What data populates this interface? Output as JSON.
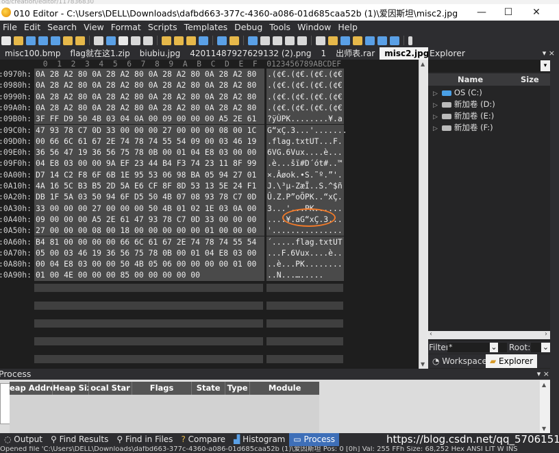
{
  "top_strip": "og/creation/editor/117836830",
  "window": {
    "title": "010 Editor - C:\\Users\\DELL\\Downloads\\dafbd663-377c-4360-a086-01d685caa52b (1)\\爱因斯坦\\misc2.jpg",
    "minimize": "—",
    "maximize": "☐",
    "close": "✕"
  },
  "menu": [
    "File",
    "Edit",
    "Search",
    "View",
    "Format",
    "Scripts",
    "Templates",
    "Debug",
    "Tools",
    "Window",
    "Help"
  ],
  "tabs": [
    "misc100.bmp",
    "flag就在这1.zip",
    "biubiu.jpg",
    "42011487927629132 (2).png",
    "1",
    "出师表.rar",
    "misc2.jpg"
  ],
  "tab_close": "×",
  "tab_arrows": "‹ › ▿",
  "explorer": {
    "title": "Explorer",
    "title_controls": "▾ ×",
    "dropdown_arrow": "▾",
    "col_name": "Name",
    "col_size": "Size",
    "items": [
      "OS (C:)",
      "新加卷 (D:)",
      "新加卷 (E:)",
      "新加卷 (F:)"
    ],
    "filter_label": "Filter:",
    "filter_value": "*",
    "root_label": "Root:",
    "tab_workspace": "Workspace",
    "tab_explorer": "Explorer"
  },
  "hex": {
    "header": " 0  1  2  3  4  5  6  7  8  9  A  B  C  D  E  F  0123456789ABCDEF",
    "rows": [
      {
        "addr": ":0970h:",
        "hex": "0A 28 A2 80 0A 28 A2 80 0A 28 A2 80 0A 28 A2 80",
        "ascii": ".(¢€.(¢€.(¢€.(¢€"
      },
      {
        "addr": ":0980h:",
        "hex": "0A 28 A2 80 0A 28 A2 80 0A 28 A2 80 0A 28 A2 80",
        "ascii": ".(¢€.(¢€.(¢€.(¢€"
      },
      {
        "addr": ":0990h:",
        "hex": "0A 28 A2 80 0A 28 A2 80 0A 28 A2 80 0A 28 A2 80",
        "ascii": ".(¢€.(¢€.(¢€.(¢€"
      },
      {
        "addr": ":09A0h:",
        "hex": "0A 28 A2 80 0A 28 A2 80 0A 28 A2 80 0A 28 A2 80",
        "ascii": ".(¢€.(¢€.(¢€.(¢€"
      },
      {
        "addr": ":09B0h:",
        "hex": "3F FF D9 50 4B 03 04 0A 00 09 00 00 00 A5 2E 61",
        "ascii": "?ÿÙPK........¥.a"
      },
      {
        "addr": ":09C0h:",
        "hex": "47 93 78 C7 0D 33 00 00 00 27 00 00 00 08 00 1C",
        "ascii": "G“xÇ.3...'......."
      },
      {
        "addr": ":09D0h:",
        "hex": "00 66 6C 61 67 2E 74 78 74 55 54 09 00 03 46 19",
        "ascii": ".flag.txtUT...F."
      },
      {
        "addr": ":09E0h:",
        "hex": "36 56 47 19 36 56 75 78 0B 00 01 04 E8 03 00 00",
        "ascii": "6VG.6Vux....è..."
      },
      {
        "addr": ":09F0h:",
        "hex": "04 E8 03 00 00 9A EF 23 44 B4 F3 74 23 11 8F 99",
        "ascii": ".è...šï#D´ót#..™"
      },
      {
        "addr": ":0A00h:",
        "hex": "D7 14 C2 F8 6F 6B 1E 95 53 06 98 BA 05 94 27 01",
        "ascii": "×.Âøok.•S.˜º.”'."
      },
      {
        "addr": ":0A10h:",
        "hex": "4A 16 5C B3 B5 2D 5A E6 CF 8F 8D 53 13 5E 24 F1",
        "ascii": "J.\\³µ-ZæÏ..S.^$ñ"
      },
      {
        "addr": ":0A20h:",
        "hex": "DB 1F 5A 03 50 94 6F D5 50 4B 07 08 93 78 C7 0D",
        "ascii": "Û.Z.P”oÕPK..“xÇ."
      },
      {
        "addr": ":0A30h:",
        "hex": "33 00 00 00 27 00 00 00 50 4B 01 02 1E 03 0A 00",
        "ascii": "3...'...PK......"
      },
      {
        "addr": ":0A40h:",
        "hex": "09 00 00 00 A5 2E 61 47 93 78 C7 0D 33 00 00 00",
        "ascii": "....¥.aG“xÇ.3..."
      },
      {
        "addr": ":0A50h:",
        "hex": "27 00 00 00 08 00 18 00 00 00 00 00 01 00 00 00",
        "ascii": "'..............."
      },
      {
        "addr": ":0A60h:",
        "hex": "B4 81 00 00 00 00 66 6C 61 67 2E 74 78 74 55 54",
        "ascii": "´.....flag.txtUT"
      },
      {
        "addr": ":0A70h:",
        "hex": "05 00 03 46 19 36 56 75 78 0B 00 01 04 E8 03 00",
        "ascii": "...F.6Vux....è.."
      },
      {
        "addr": ":0A80h:",
        "hex": "00 04 E8 03 00 00 50 4B 05 06 00 00 00 00 01 00",
        "ascii": "..è...PK........"
      },
      {
        "addr": ":0A90h:",
        "hex": "01 00 4E 00 00 00 85 00 00 00 00 00",
        "ascii": "..N...…....."
      }
    ]
  },
  "process": {
    "title": "Process",
    "title_controls": "▾ ×",
    "columns": [
      "eap Addres",
      "Heap Size",
      "ocal Star",
      "Flags",
      "State",
      "Type",
      "Module"
    ]
  },
  "bottom_tabs": [
    "Output",
    "Find Results",
    "Find in Files",
    "Compare",
    "Histogram",
    "Process"
  ],
  "watermark": "https://blog.csdn.net/qq_57061511",
  "status": "Opened file 'C:\\Users\\DELL\\Downloads\\dafbd663-377c-4360-a086-01d685caa52b (1)\\爱因斯坦 Pos: 0 [0h]  Val: 255 FFh  Size: 68,252     Hex  ANSI  LIT     W  INS",
  "colors": {
    "dark": "#2d2d30",
    "hex_bg": "#1e1e1e",
    "cell_bg": "#4a4a4a",
    "highlight": "#f07a2a",
    "active_bottom_tab": "#3e6fb8"
  }
}
